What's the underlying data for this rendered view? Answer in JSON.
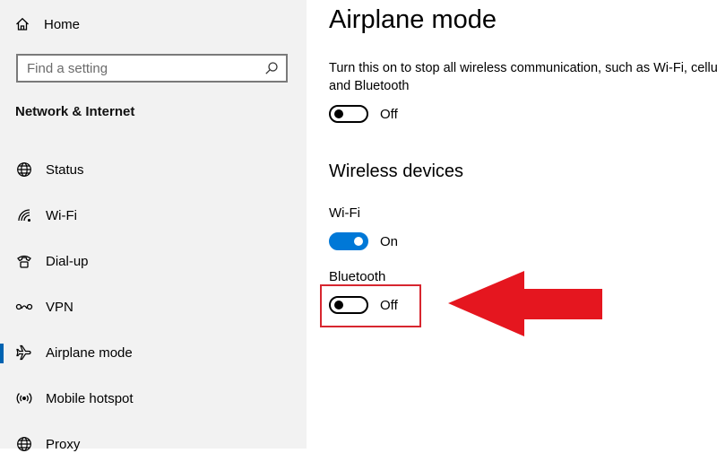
{
  "sidebar": {
    "home_label": "Home",
    "search_placeholder": "Find a setting",
    "section_title": "Network & Internet",
    "items": [
      {
        "label": "Status",
        "icon": "globe-icon"
      },
      {
        "label": "Wi-Fi",
        "icon": "wifi-icon"
      },
      {
        "label": "Dial-up",
        "icon": "dialup-icon"
      },
      {
        "label": "VPN",
        "icon": "vpn-icon"
      },
      {
        "label": "Airplane mode",
        "icon": "airplane-icon",
        "active": true
      },
      {
        "label": "Mobile hotspot",
        "icon": "hotspot-icon"
      },
      {
        "label": "Proxy",
        "icon": "globe-icon"
      }
    ]
  },
  "main": {
    "title": "Airplane mode",
    "description": "Turn this on to stop all wireless communication, such as Wi-Fi, cellular, and Bluetooth",
    "airplane_toggle": {
      "state": "Off",
      "on": false
    },
    "wireless_title": "Wireless devices",
    "wifi": {
      "label": "Wi-Fi",
      "state": "On",
      "on": true
    },
    "bluetooth": {
      "label": "Bluetooth",
      "state": "Off",
      "on": false
    }
  },
  "annotation": {
    "highlight_color": "#d7262f",
    "arrow_color": "#e5161f",
    "arrow_direction": "left"
  },
  "colors": {
    "accent": "#0078d7",
    "sidebar_bg": "#f2f2f2"
  }
}
